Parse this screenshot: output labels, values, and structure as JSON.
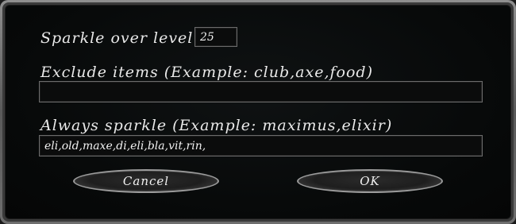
{
  "dialog": {
    "sparkle_over_level": {
      "label": "Sparkle over level",
      "value": "25"
    },
    "exclude_items": {
      "label": "Exclude items (Example: club,axe,food)",
      "value": ""
    },
    "always_sparkle": {
      "label": "Always sparkle (Example: maximus,elixir)",
      "value": "eli,old,maxe,di,eli,bla,vit,rin,"
    },
    "buttons": {
      "cancel": "Cancel",
      "ok": "OK"
    }
  }
}
